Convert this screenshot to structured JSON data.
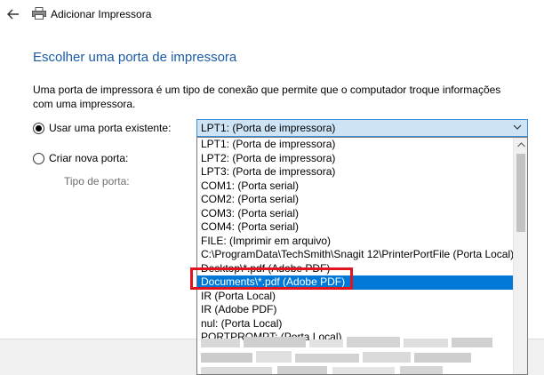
{
  "window": {
    "title": "Adicionar Impressora"
  },
  "heading": "Escolher uma porta de impressora",
  "description": "Uma porta de impressora é um tipo de conexão que permite que o computador troque informações com uma impressora.",
  "options": {
    "existing_label": "Usar uma porta existente:",
    "new_label": "Criar nova porta:",
    "existing_checked": true,
    "new_checked": false,
    "port_type_label": "Tipo de porta:"
  },
  "combo": {
    "selected_value": "LPT1: (Porta de impressora)"
  },
  "dropdown_items": [
    "LPT1: (Porta de impressora)",
    "LPT2: (Porta de impressora)",
    "LPT3: (Porta de impressora)",
    "COM1: (Porta serial)",
    "COM2: (Porta serial)",
    "COM3: (Porta serial)",
    "COM4: (Porta serial)",
    "FILE: (Imprimir em arquivo)",
    "C:\\ProgramData\\TechSmith\\Snagit 12\\PrinterPortFile (Porta Local)",
    "Desktop\\*.pdf (Adobe PDF)",
    "Documents\\*.pdf (Adobe PDF)",
    "IR (Porta Local)",
    "IR (Adobe PDF)",
    "nul: (Porta Local)",
    "PORTPROMPT: (Porta Local)"
  ],
  "selected_index": 10,
  "colors": {
    "accent": "#0078d7",
    "heading": "#1a5aa6",
    "highlight": "#e0141e"
  },
  "icons": {
    "back": "back-arrow-icon",
    "printer": "printer-icon",
    "chevron": "chevron-down-icon"
  }
}
